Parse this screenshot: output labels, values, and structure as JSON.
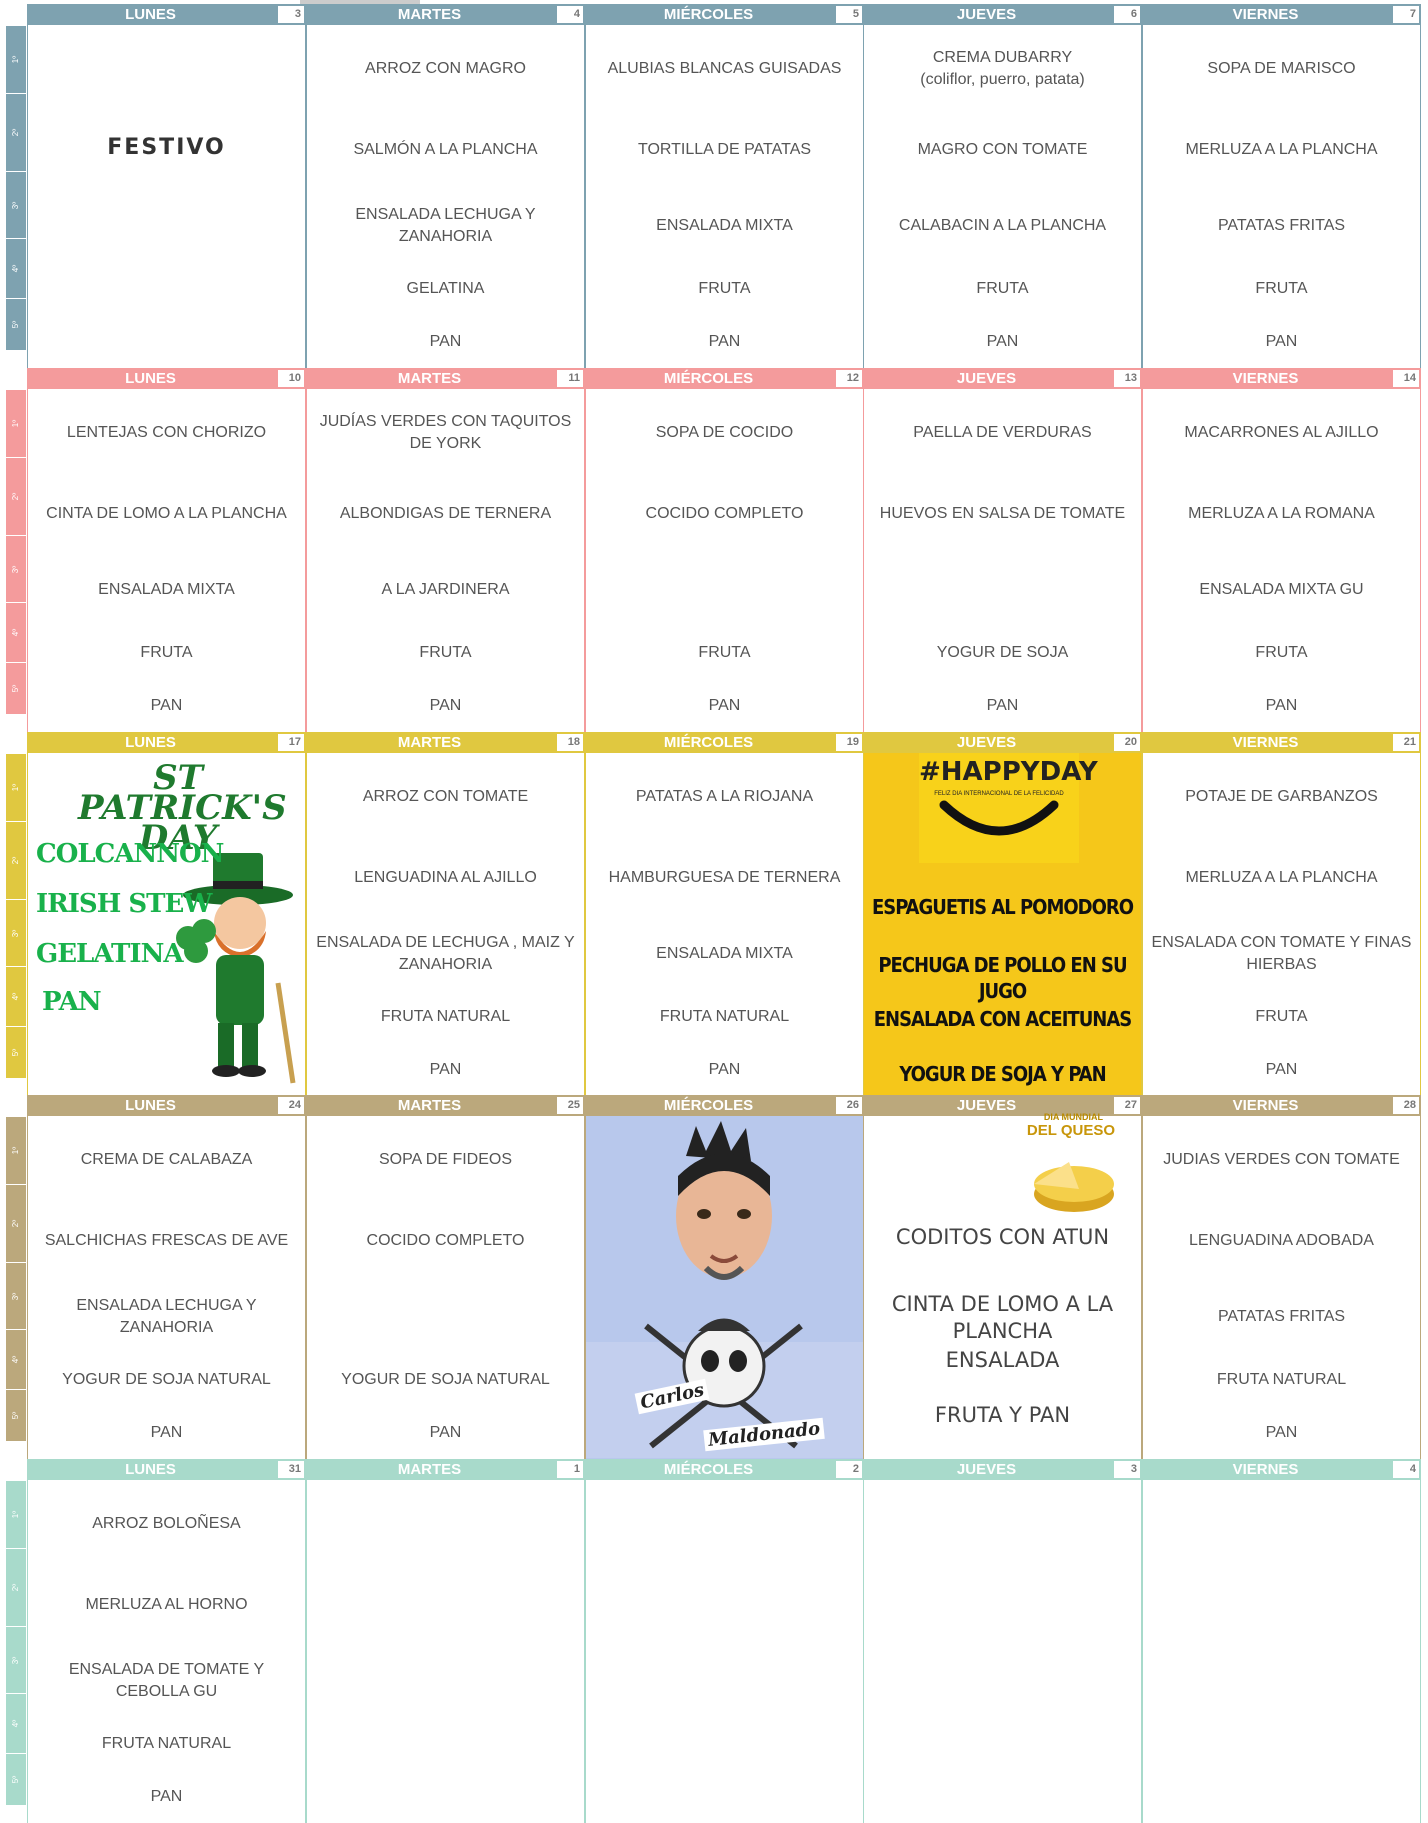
{
  "weeks": [
    {
      "color": "#7ea2b0",
      "side_labels": [
        "1º",
        "2º",
        "3º",
        "4º",
        "5º"
      ],
      "days": [
        {
          "name": "LUNES",
          "num": "3",
          "festivo": "FESTIVO"
        },
        {
          "name": "MARTES",
          "num": "4",
          "items": [
            "ARROZ CON MAGRO",
            "SALMÓN A LA PLANCHA",
            "ENSALADA LECHUGA Y ZANAHORIA",
            "GELATINA",
            "PAN"
          ]
        },
        {
          "name": "MIÉRCOLES",
          "num": "5",
          "items": [
            "ALUBIAS BLANCAS GUISADAS",
            "TORTILLA DE PATATAS",
            "ENSALADA MIXTA",
            "FRUTA",
            "PAN"
          ]
        },
        {
          "name": "JUEVES",
          "num": "6",
          "items": [
            "CREMA DUBARRY\n(coliflor, puerro, patata)",
            "MAGRO CON TOMATE",
            "CALABACIN A LA PLANCHA",
            "FRUTA",
            "PAN"
          ]
        },
        {
          "name": "VIERNES",
          "num": "7",
          "items": [
            "SOPA DE MARISCO",
            "MERLUZA A LA PLANCHA",
            "PATATAS FRITAS",
            "FRUTA",
            "PAN"
          ]
        }
      ]
    },
    {
      "color": "#f49b9c",
      "side_labels": [
        "1º",
        "2º",
        "3º",
        "4º",
        "5º"
      ],
      "days": [
        {
          "name": "LUNES",
          "num": "10",
          "items": [
            "LENTEJAS CON CHORIZO",
            "CINTA DE LOMO A LA PLANCHA",
            "ENSALADA MIXTA",
            "FRUTA",
            "PAN"
          ]
        },
        {
          "name": "MARTES",
          "num": "11",
          "items": [
            "JUDÍAS VERDES CON TAQUITOS DE YORK",
            "ALBONDIGAS DE TERNERA",
            "A LA JARDINERA",
            "FRUTA",
            "PAN"
          ]
        },
        {
          "name": "MIÉRCOLES",
          "num": "12",
          "items": [
            "SOPA DE COCIDO",
            "COCIDO COMPLETO",
            "",
            "FRUTA",
            "PAN"
          ]
        },
        {
          "name": "JUEVES",
          "num": "13",
          "items": [
            "PAELLA DE VERDURAS",
            "HUEVOS EN SALSA DE TOMATE",
            "",
            "YOGUR DE SOJA",
            "PAN"
          ]
        },
        {
          "name": "VIERNES",
          "num": "14",
          "items": [
            "MACARRONES AL AJILLO",
            "MERLUZA A LA ROMANA",
            "ENSALADA MIXTA GU",
            "FRUTA",
            "PAN"
          ]
        }
      ]
    },
    {
      "color": "#e0c840",
      "side_labels": [
        "1º",
        "2º",
        "3º",
        "4º",
        "5º"
      ],
      "days": [
        {
          "name": "LUNES",
          "num": "17",
          "stpatrick": {
            "title": "ST PATRICK'S DAY",
            "items": [
              "COLCANNON",
              "IRISH STEW",
              "GELATINA",
              "PAN"
            ]
          }
        },
        {
          "name": "MARTES",
          "num": "18",
          "items": [
            "ARROZ CON TOMATE",
            "LENGUADINA AL AJILLO",
            "ENSALADA DE LECHUGA , MAIZ Y ZANAHORIA",
            "FRUTA NATURAL",
            "PAN"
          ]
        },
        {
          "name": "MIÉRCOLES",
          "num": "19",
          "items": [
            "PATATAS A LA RIOJANA",
            "HAMBURGUESA DE TERNERA",
            "ENSALADA MIXTA",
            "FRUTA NATURAL",
            "PAN"
          ]
        },
        {
          "name": "JUEVES",
          "num": "20",
          "happy": {
            "tag": "#HAPPYDAY",
            "sub": "FELIZ DIA INTERNACIONAL DE LA FELICIDAD",
            "items": [
              "ESPAGUETIS AL POMODORO",
              "PECHUGA DE POLLO EN SU JUGO",
              "ENSALADA CON ACEITUNAS",
              "YOGUR DE SOJA Y PAN"
            ]
          }
        },
        {
          "name": "VIERNES",
          "num": "21",
          "items": [
            "POTAJE DE GARBANZOS",
            "MERLUZA A LA PLANCHA",
            "ENSALADA CON TOMATE Y FINAS HIERBAS",
            "FRUTA",
            "PAN"
          ]
        }
      ]
    },
    {
      "color": "#bba87c",
      "side_labels": [
        "1º",
        "2º",
        "3º",
        "4º",
        "5º"
      ],
      "days": [
        {
          "name": "LUNES",
          "num": "24",
          "items": [
            "CREMA DE CALABAZA",
            "SALCHICHAS FRESCAS DE AVE",
            "ENSALADA LECHUGA Y ZANAHORIA",
            "YOGUR DE SOJA NATURAL",
            "PAN"
          ]
        },
        {
          "name": "MARTES",
          "num": "25",
          "items": [
            "SOPA DE FIDEOS",
            "COCIDO COMPLETO",
            "",
            "YOGUR DE SOJA NATURAL",
            "PAN"
          ]
        },
        {
          "name": "MIÉRCOLES",
          "num": "26",
          "carlos": {
            "line1": "Carlos",
            "line2": "Maldonado"
          }
        },
        {
          "name": "JUEVES",
          "num": "27",
          "queso": {
            "badge1": "DIA MUNDIAL",
            "badge2": "DEL QUESO",
            "items": [
              "CODITOS CON ATUN",
              "CINTA DE LOMO A LA PLANCHA",
              "ENSALADA",
              "FRUTA Y PAN"
            ]
          }
        },
        {
          "name": "VIERNES",
          "num": "28",
          "items": [
            "JUDIAS VERDES CON TOMATE",
            "LENGUADINA ADOBADA",
            "PATATAS FRITAS",
            "FRUTA NATURAL",
            "PAN"
          ]
        }
      ]
    },
    {
      "color": "#a8dacb",
      "side_labels": [
        "1º",
        "2º",
        "3º",
        "4º",
        "5º"
      ],
      "days": [
        {
          "name": "LUNES",
          "num": "31",
          "items": [
            "ARROZ BOLOÑESA",
            "MERLUZA AL HORNO",
            "ENSALADA DE TOMATE Y CEBOLLA GU",
            "FRUTA NATURAL",
            "PAN"
          ]
        },
        {
          "name": "MARTES",
          "num": "1",
          "items": [
            "",
            "",
            "",
            "",
            ""
          ]
        },
        {
          "name": "MIÉRCOLES",
          "num": "2",
          "items": [
            "",
            "",
            "",
            "",
            ""
          ]
        },
        {
          "name": "JUEVES",
          "num": "3",
          "items": [
            "",
            "",
            "",
            "",
            ""
          ]
        },
        {
          "name": "VIERNES",
          "num": "4",
          "items": [
            "",
            "",
            "",
            "",
            ""
          ]
        }
      ]
    }
  ]
}
